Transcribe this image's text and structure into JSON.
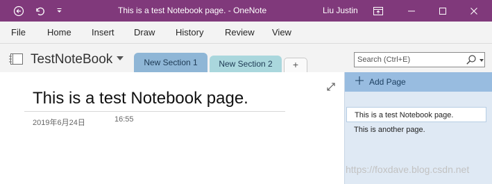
{
  "window": {
    "title": "This is a test Notebook page.  -  OneNote",
    "user": "Liu Justin"
  },
  "icons": {
    "back": "back-icon",
    "undo": "undo-icon",
    "qat": "quick-access-dropdown-icon",
    "ribbon_display": "ribbon-display-options-icon",
    "minimize": "minimize-icon",
    "maximize": "maximize-icon",
    "close": "close-icon",
    "notebook": "notebook-icon",
    "search": "search-icon",
    "expand": "expand-icon",
    "add_page": "plus-icon"
  },
  "ribbon": {
    "tabs": [
      "File",
      "Home",
      "Insert",
      "Draw",
      "History",
      "Review",
      "View"
    ]
  },
  "notebook": {
    "name": "TestNoteBook",
    "sections": [
      {
        "label": "New Section 1",
        "active": true,
        "color": "#8fb6d6"
      },
      {
        "label": "New Section 2",
        "active": false,
        "color": "#aad7dd"
      }
    ],
    "add_section": "+"
  },
  "search": {
    "placeholder": "Search (Ctrl+E)"
  },
  "page": {
    "title": "This is a test Notebook page.",
    "date": "2019年6月24日",
    "time": "16:55"
  },
  "pages_pane": {
    "add_label": "Add Page",
    "pages": [
      "This is a test Notebook page.",
      "This is another page."
    ]
  },
  "watermark": "https://foxdave.blog.csdn.net",
  "colors": {
    "accent": "#80397b",
    "section_active": "#8fb6d6",
    "pane_bg": "#dfe9f4"
  }
}
